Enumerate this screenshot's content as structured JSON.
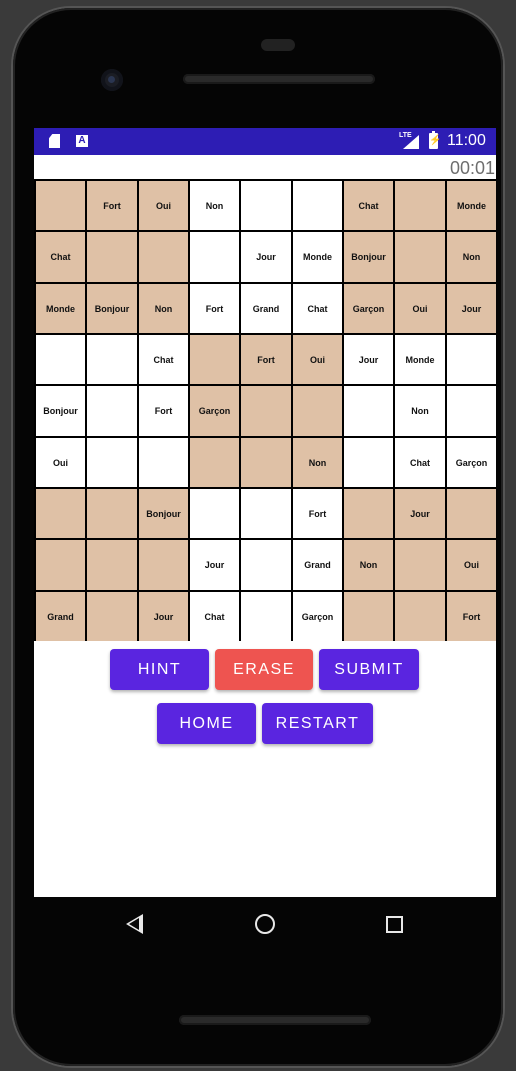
{
  "status_bar": {
    "network": "LTE",
    "sd_icon": "sd-card-icon",
    "a_icon_label": "A",
    "time": "11:00"
  },
  "timer": "00:01",
  "grid": [
    [
      "",
      "Fort",
      "Oui",
      "Non",
      "",
      "",
      "Chat",
      "",
      "Monde"
    ],
    [
      "Chat",
      "",
      "",
      "",
      "Jour",
      "Monde",
      "Bonjour",
      "",
      "Non"
    ],
    [
      "Monde",
      "Bonjour",
      "Non",
      "Fort",
      "Grand",
      "Chat",
      "Garçon",
      "Oui",
      "Jour"
    ],
    [
      "",
      "",
      "Chat",
      "",
      "Fort",
      "Oui",
      "Jour",
      "Monde",
      ""
    ],
    [
      "Bonjour",
      "",
      "Fort",
      "Garçon",
      "",
      "",
      "",
      "Non",
      ""
    ],
    [
      "Oui",
      "",
      "",
      "",
      "",
      "Non",
      "",
      "Chat",
      "Garçon"
    ],
    [
      "",
      "",
      "Bonjour",
      "",
      "",
      "Fort",
      "",
      "Jour",
      ""
    ],
    [
      "",
      "",
      "",
      "Jour",
      "",
      "Grand",
      "Non",
      "",
      "Oui"
    ],
    [
      "Grand",
      "",
      "Jour",
      "Chat",
      "",
      "Garçon",
      "",
      "",
      "Fort"
    ]
  ],
  "given_mask": [
    [
      1,
      1,
      1,
      0,
      0,
      0,
      1,
      1,
      1
    ],
    [
      1,
      1,
      1,
      0,
      0,
      0,
      1,
      1,
      1
    ],
    [
      1,
      1,
      1,
      0,
      0,
      0,
      1,
      1,
      1
    ],
    [
      0,
      0,
      0,
      1,
      1,
      1,
      0,
      0,
      0
    ],
    [
      0,
      0,
      0,
      1,
      1,
      1,
      0,
      0,
      0
    ],
    [
      0,
      0,
      0,
      1,
      1,
      1,
      0,
      0,
      0
    ],
    [
      1,
      1,
      1,
      0,
      0,
      0,
      1,
      1,
      1
    ],
    [
      1,
      1,
      1,
      0,
      0,
      0,
      1,
      1,
      1
    ],
    [
      1,
      1,
      1,
      0,
      0,
      0,
      1,
      1,
      1
    ]
  ],
  "colors": {
    "status_bar": "#2d1db4",
    "filled_cell": "#dfc1a6",
    "blank_cell": "#ffffff",
    "primary_button": "#5a25e0",
    "erase_button": "#ee5450"
  },
  "buttons": {
    "hint": "HINT",
    "erase": "ERASE",
    "submit": "SUBMIT",
    "home": "HOME",
    "restart": "RESTART"
  },
  "nav": {
    "back_icon": "back-triangle-icon",
    "home_icon": "home-circle-icon",
    "recent_icon": "recent-apps-square-icon"
  }
}
